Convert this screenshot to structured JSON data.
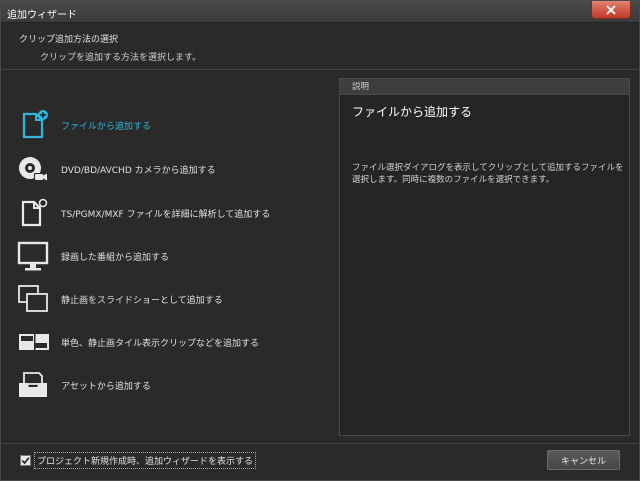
{
  "window": {
    "title": "追加ウィザード"
  },
  "header": {
    "title": "クリップ追加方法の選択",
    "subtitle": "クリップを追加する方法を選択します。"
  },
  "options": [
    {
      "label": "ファイルから追加する",
      "icon": "file-add-icon",
      "active": true
    },
    {
      "label": "DVD/BD/AVCHD カメラから追加する",
      "icon": "disc-camera-icon",
      "active": false
    },
    {
      "label": "TS/PGMX/MXF ファイルを詳細に解析して追加する",
      "icon": "file-search-icon",
      "active": false
    },
    {
      "label": "録画した番組から追加する",
      "icon": "monitor-icon",
      "active": false
    },
    {
      "label": "静止画をスライドショーとして追加する",
      "icon": "slideshow-icon",
      "active": false
    },
    {
      "label": "単色、静止画タイル表示クリップなどを追加する",
      "icon": "tile-icon",
      "active": false
    },
    {
      "label": "アセットから追加する",
      "icon": "asset-tray-icon",
      "active": false
    }
  ],
  "description": {
    "header": "説明",
    "title": "ファイルから追加する",
    "body": "ファイル選択ダイアログを表示してクリップとして追加するファイルを選択します。同時に複数のファイルを選択できます。"
  },
  "footer": {
    "checkbox_label": "プロジェクト新規作成時、追加ウィザードを表示する",
    "checkbox_checked": true,
    "cancel_label": "キャンセル"
  },
  "colors": {
    "accent": "#2fb7e0",
    "close": "#c0392b",
    "background": "#2a2a2a"
  }
}
